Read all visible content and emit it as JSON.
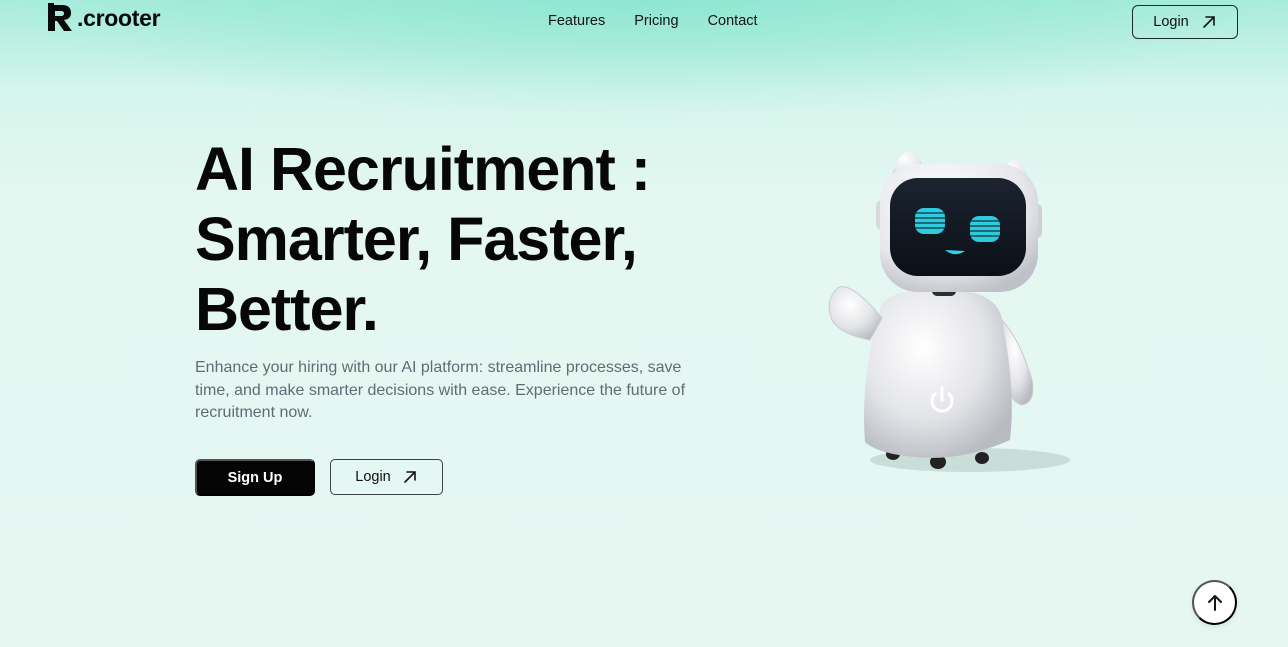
{
  "brand": {
    "name": ".crooter",
    "logo_icon": "r-logo-mark-icon"
  },
  "nav": {
    "items": [
      {
        "label": "Features"
      },
      {
        "label": "Pricing"
      },
      {
        "label": "Contact"
      }
    ],
    "login_label": "Login",
    "login_icon": "arrow-up-right-icon"
  },
  "hero": {
    "title_lines": [
      "AI Recruitment :",
      "Smarter, Faster,",
      "Better."
    ],
    "description": "Enhance your hiring with our AI platform: streamline processes, save time, and make smarter decisions with ease. Experience the future of recruitment now.",
    "signup_label": "Sign Up",
    "login_label": "Login",
    "login_icon": "arrow-up-right-icon",
    "image": "robot-illustration"
  },
  "scroll_top": {
    "icon": "arrow-up-icon"
  },
  "colors": {
    "background": "#e6f7f2",
    "header_glow": "#a8ecdc",
    "primary_button": "#050505",
    "text": "#070707",
    "muted_text": "#5f6c76",
    "robot_eyes": "#2fd4e8"
  }
}
